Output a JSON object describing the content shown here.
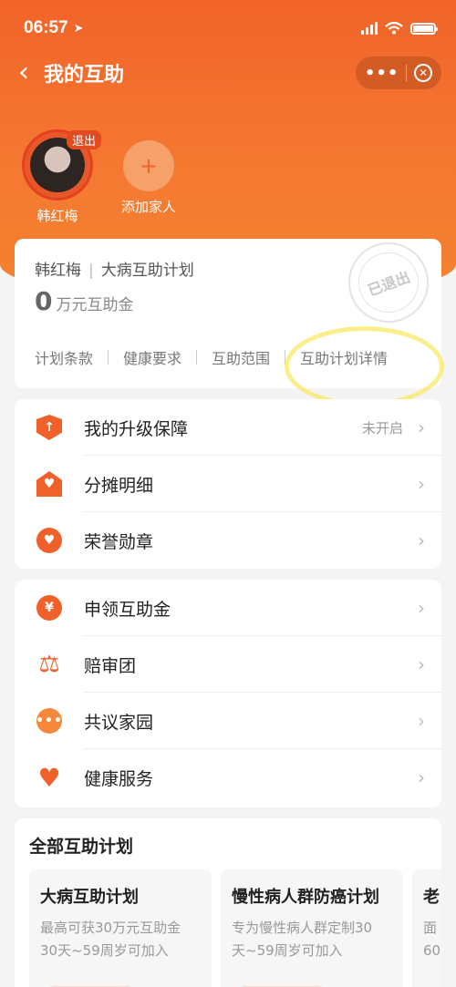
{
  "status_bar": {
    "time": "06:57"
  },
  "nav": {
    "title": "我的互助",
    "more": "•••"
  },
  "members": [
    {
      "name": "韩红梅",
      "tag": "退出"
    },
    {
      "name": "添加家人",
      "symbol": "+"
    }
  ],
  "plan_card": {
    "member": "韩红梅",
    "separator": "|",
    "plan": "大病互助计划",
    "amount": "0",
    "amount_unit": "万元互助金",
    "stamp": "已退出",
    "links": [
      "计划条款",
      "健康要求",
      "互助范围",
      "互助计划详情"
    ]
  },
  "menu_group_1": [
    {
      "label": "我的升级保障",
      "status": "未开启",
      "icon": "shield-up-icon"
    },
    {
      "label": "分摊明细",
      "icon": "house-heart-icon"
    },
    {
      "label": "荣誉勋章",
      "icon": "medal-icon"
    }
  ],
  "menu_group_2": [
    {
      "label": "申领互助金",
      "icon": "yuan-coin-icon"
    },
    {
      "label": "赔审团",
      "icon": "scale-icon"
    },
    {
      "label": "共议家园",
      "icon": "chat-bubble-icon"
    },
    {
      "label": "健康服务",
      "icon": "heart-hand-icon"
    }
  ],
  "all_plans": {
    "title": "全部互助计划",
    "tiles": [
      {
        "title": "大病互助计划",
        "desc1": "最高可获30万元互助金",
        "desc2": "30天~59周岁可加入"
      },
      {
        "title": "慢性病人群防癌计划",
        "desc1": "专为慢性病人群定制30",
        "desc2": "天~59周岁可加入"
      },
      {
        "title": "老",
        "desc1": "面",
        "desc2": "60"
      }
    ]
  },
  "colors": {
    "brand": "#f0602a",
    "highlight": "#fae85a"
  }
}
